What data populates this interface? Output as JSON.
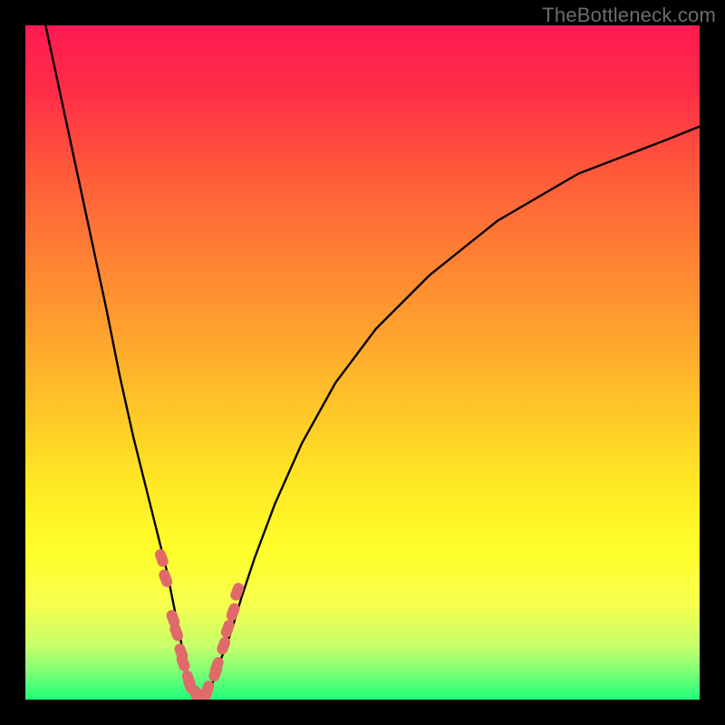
{
  "watermark": "TheBottleneck.com",
  "colors": {
    "curve": "#000000",
    "marker_fill": "#e06a6a",
    "marker_stroke": "#c85a5a",
    "gradient_top": "#ff1a52",
    "gradient_bottom": "#1dff7b",
    "frame": "#000000"
  },
  "chart_data": {
    "type": "line",
    "title": "",
    "xlabel": "",
    "ylabel": "",
    "xlim": [
      0,
      100
    ],
    "ylim": [
      0,
      100
    ],
    "series": [
      {
        "name": "left-branch",
        "x": [
          3,
          6,
          9,
          12,
          14,
          16,
          18,
          19.5,
          21,
          22.2,
          23.2,
          24,
          25,
          26
        ],
        "y": [
          100,
          86,
          72,
          58,
          48,
          39,
          31,
          25,
          19,
          13,
          8,
          4,
          1,
          0
        ]
      },
      {
        "name": "right-branch",
        "x": [
          26,
          27,
          28,
          29,
          30.5,
          32,
          34,
          37,
          41,
          46,
          52,
          60,
          70,
          82,
          95,
          100
        ],
        "y": [
          0,
          1,
          3,
          6,
          10,
          15,
          21,
          29,
          38,
          47,
          55,
          63,
          71,
          78,
          83,
          85
        ]
      },
      {
        "name": "markers-left",
        "x": [
          20.2,
          20.8,
          21.9,
          22.4,
          23.1,
          23.4,
          24.2,
          24.4,
          25.3
        ],
        "y": [
          21,
          18,
          12,
          10,
          7,
          5.5,
          3,
          2.2,
          0.8
        ]
      },
      {
        "name": "markers-right",
        "x": [
          26.8,
          27.0,
          28.2,
          28.4,
          29.4,
          30.0,
          30.8,
          31.4
        ],
        "y": [
          0.8,
          1.5,
          4,
          5,
          8,
          10.5,
          13,
          16
        ]
      },
      {
        "name": "markers-bottom",
        "x": [
          25.6,
          26.1,
          26.5
        ],
        "y": [
          0.2,
          0.1,
          0.3
        ]
      }
    ],
    "grid": false,
    "legend": false
  }
}
